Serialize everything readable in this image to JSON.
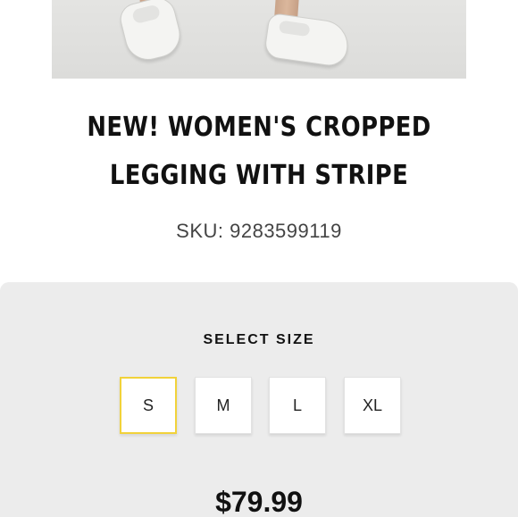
{
  "product": {
    "title_line1": "NEW! WOMEN'S CROPPED",
    "title_line2": "LEGGING WITH STRIPE",
    "sku": "SKU: 9283599119",
    "price": "$79.99"
  },
  "size_selector": {
    "heading": "SELECT SIZE",
    "options": [
      "S",
      "M",
      "L",
      "XL"
    ],
    "selected": "S"
  },
  "colors": {
    "selected_border": "#f1d23a",
    "panel_background": "#ececec"
  }
}
